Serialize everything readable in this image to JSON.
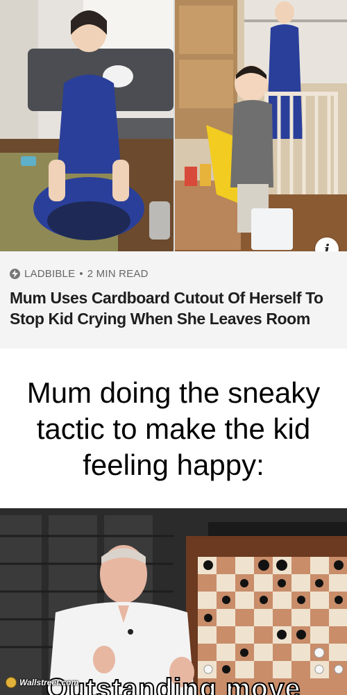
{
  "article": {
    "source": "LADBIBLE",
    "separator": "•",
    "read_time": "2 MIN READ",
    "headline": "Mum Uses Cardboard Cutout Of Herself To Stop Kid Crying When She Leaves Room",
    "info_icon": "i"
  },
  "caption": {
    "text": "Mum doing the sneaky tactic to make the kid feeling happy:"
  },
  "meme": {
    "overlay_text": "Outstanding move",
    "watermark": "Wallstreet.com"
  },
  "colors": {
    "card_background": "#f4f4f4",
    "source_text": "#666666",
    "headline_text": "#1e1e1e"
  }
}
